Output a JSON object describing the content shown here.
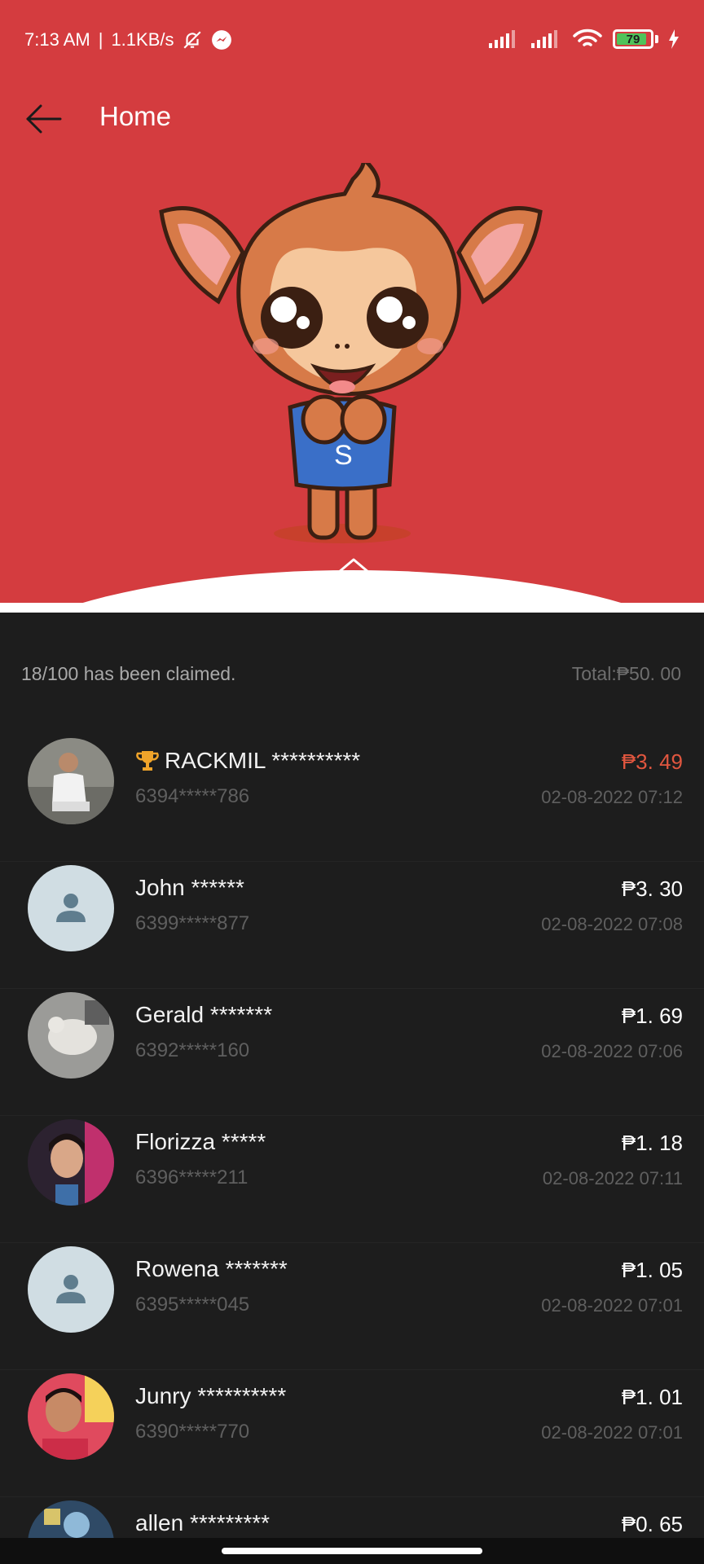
{
  "status_bar": {
    "time": "7:13 AM",
    "network_speed": "1.1KB/s",
    "battery": "79",
    "battery_level": 0.79,
    "icons": [
      "bell-muted-icon",
      "messenger-icon",
      "signal-icon",
      "signal-icon",
      "wifi-icon",
      "battery-icon",
      "charging-icon"
    ]
  },
  "appbar": {
    "title": "Home"
  },
  "summary": {
    "claimed": "18/100 has been claimed.",
    "total": "Total:₱50. 00"
  },
  "claims": [
    {
      "name": "RACKMIL **********",
      "phone": "6394*****786",
      "amount": "₱3. 49",
      "time": "02-08-2022 07:12",
      "top": true,
      "avatar": "photo"
    },
    {
      "name": "John ******",
      "phone": "6399*****877",
      "amount": "₱3. 30",
      "time": "02-08-2022 07:08",
      "top": false,
      "avatar": "default"
    },
    {
      "name": "Gerald *******",
      "phone": "6392*****160",
      "amount": "₱1. 69",
      "time": "02-08-2022 07:06",
      "top": false,
      "avatar": "photo"
    },
    {
      "name": "Florizza *****",
      "phone": "6396*****211",
      "amount": "₱1. 18",
      "time": "02-08-2022 07:11",
      "top": false,
      "avatar": "photo"
    },
    {
      "name": "Rowena *******",
      "phone": "6395*****045",
      "amount": "₱1. 05",
      "time": "02-08-2022 07:01",
      "top": false,
      "avatar": "default"
    },
    {
      "name": "Junry **********",
      "phone": "6390*****770",
      "amount": "₱1. 01",
      "time": "02-08-2022 07:01",
      "top": false,
      "avatar": "photo"
    },
    {
      "name": "allen *********",
      "phone": "",
      "amount": "₱0. 65",
      "time": "",
      "top": false,
      "avatar": "photo"
    }
  ],
  "colors": {
    "header": "#d43c3f",
    "background": "#1d1d1d",
    "top_amount": "#e0563f"
  }
}
